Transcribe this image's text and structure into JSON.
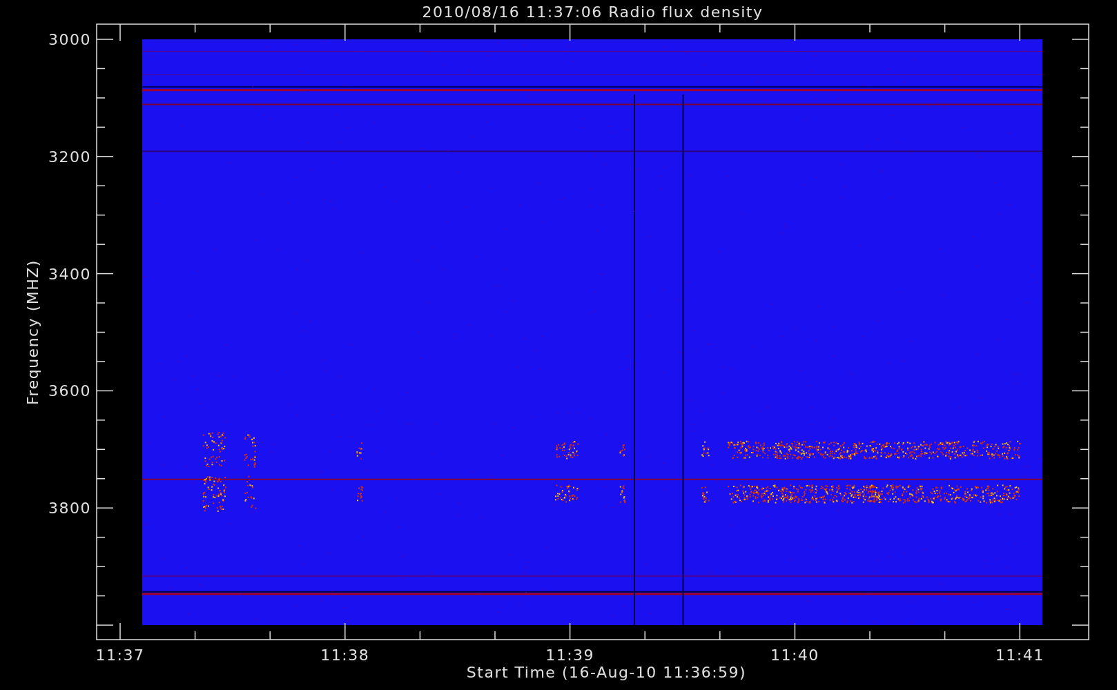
{
  "title": "2010/08/16 11:37:06 Radio flux density",
  "y_axis": {
    "label": "Frequency (MHZ)",
    "tick_labels": [
      "3000",
      "3200",
      "3400",
      "3600",
      "3800"
    ]
  },
  "x_axis": {
    "label": "Start Time (16-Aug-10 11:36:59)",
    "tick_labels": [
      "11:37",
      "11:38",
      "11:39",
      "11:40",
      "11:41"
    ]
  }
}
